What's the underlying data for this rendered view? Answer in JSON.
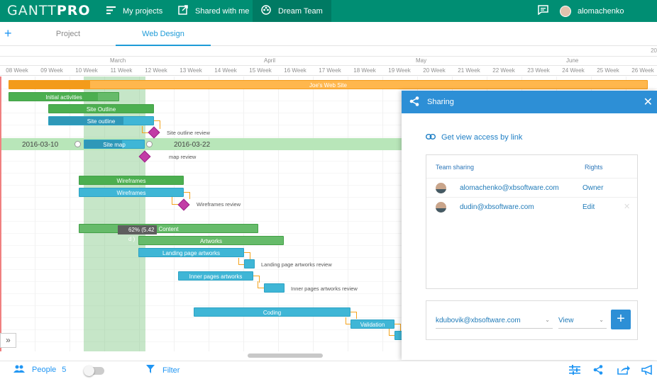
{
  "header": {
    "logo_light": "GANTT",
    "logo_bold": "PRO",
    "nav": [
      {
        "label": "My projects",
        "icon": "list-icon"
      },
      {
        "label": "Shared with me",
        "icon": "share-box-icon"
      },
      {
        "label": "Dream Team",
        "icon": "team-icon"
      }
    ],
    "username": "alomachenko"
  },
  "tabs": [
    {
      "label": "Project"
    },
    {
      "label": "Web Design"
    }
  ],
  "timeline": {
    "year_fragment": "20",
    "months": [
      "March",
      "April",
      "May",
      "June"
    ],
    "weeks": [
      "08 Week",
      "09 Week",
      "10 Week",
      "11 Week",
      "12 Week",
      "13 Week",
      "14 Week",
      "15 Week",
      "16 Week",
      "17 Week",
      "18 Week",
      "19 Week",
      "20 Week",
      "21 Week",
      "22 Week",
      "23 Week",
      "24 Week",
      "25 Week",
      "26 Week"
    ]
  },
  "tasks": {
    "project": "Joe's Web Site",
    "initial": "Initial activities",
    "site_outline_green": "Site Outline",
    "site_outline_blue": "Site outline",
    "site_outline_review": "Site outline review",
    "site_map": "Site map",
    "site_map_review": "map review",
    "wireframes_green": "Wireframes",
    "wireframes_blue": "Wireframes",
    "wireframes_review": "Wireframes review",
    "content": "Content",
    "artworks": "Artworks",
    "landing": "Landing page artworks",
    "landing_review": "Landing page artworks review",
    "inner": "Inner pages artworks",
    "inner_review": "Inner pages artworks review",
    "coding": "Coding",
    "validation": "Validation",
    "date_start": "2016-03-10",
    "date_end": "2016-03-22",
    "tooltip": "62% (5.42 d )"
  },
  "sharing": {
    "title": "Sharing",
    "view_link": "Get view access by link",
    "col_team": "Team sharing",
    "col_rights": "Rights",
    "members": [
      {
        "email": "alomachenko@xbsoftware.com",
        "role": "Owner"
      },
      {
        "email": "dudin@xbsoftware.com",
        "role": "Edit"
      }
    ],
    "invite_email": "kdubovik@xbsoftware.com",
    "invite_role": "View"
  },
  "bottom": {
    "people_label": "People",
    "people_count": "5",
    "filter_label": "Filter"
  },
  "colors": {
    "brand": "#008e73",
    "accent": "#2d8fd6",
    "milestone": "#c23ca6"
  }
}
